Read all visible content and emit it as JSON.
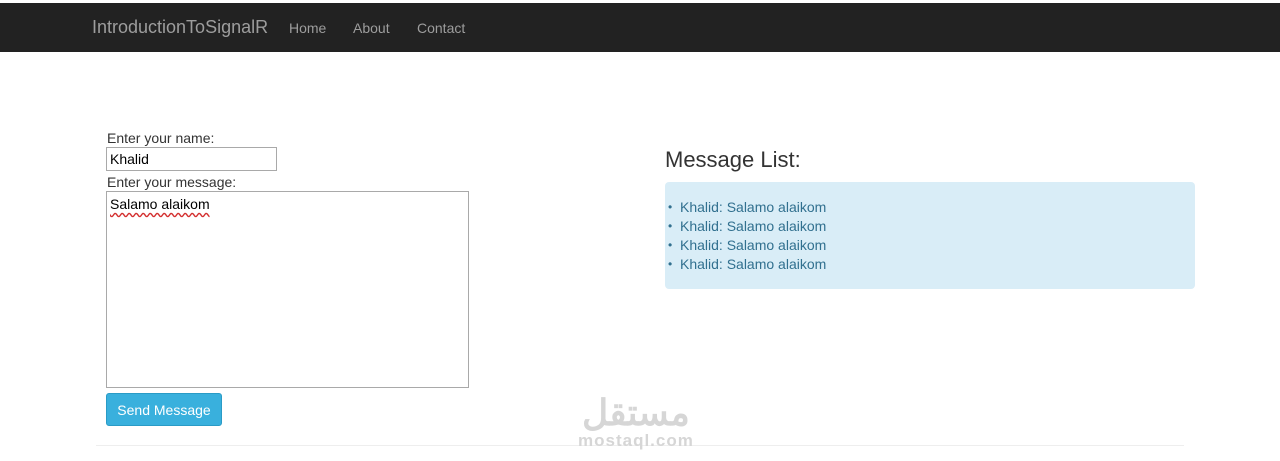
{
  "navbar": {
    "brand": "IntroductionToSignalR",
    "links": [
      "Home",
      "About",
      "Contact"
    ],
    "background": "#222222"
  },
  "form": {
    "name_label": "Enter your name:",
    "name_value": "Khalid",
    "message_label": "Enter your message:",
    "message_value": "Salamo alaikom",
    "send_label": "Send Message",
    "button_color": "#39b0dd"
  },
  "messages": {
    "title": "Message List:",
    "items": [
      "Khalid: Salamo alaikom",
      "Khalid: Salamo alaikom",
      "Khalid: Salamo alaikom",
      "Khalid: Salamo alaikom"
    ],
    "panel_color": "#d9edf7"
  },
  "watermark": {
    "arabic": "مستقل",
    "latin": "mostaql.com"
  }
}
